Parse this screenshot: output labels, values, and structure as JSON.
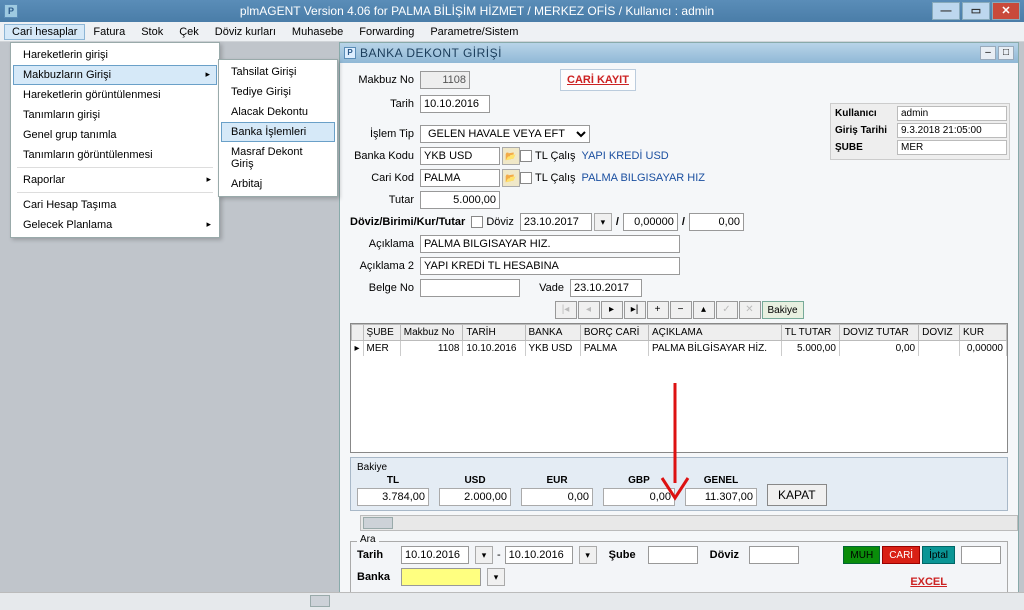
{
  "app": {
    "icon": "P",
    "title": "plmAGENT  Version 4.06 for  PALMA BİLİŞİM HİZMET  /   MERKEZ OFİS /      Kullanıcı : admin"
  },
  "menubar": [
    "Cari hesaplar",
    "Fatura",
    "Stok",
    "Çek",
    "Döviz kurları",
    "Muhasebe",
    "Forwarding",
    "Parametre/Sistem"
  ],
  "dropdown1": [
    {
      "label": "Hareketlerin girişi"
    },
    {
      "label": "Makbuzların Girişi",
      "arrow": true,
      "highlight": true
    },
    {
      "label": "Hareketlerin  görüntülenmesi"
    },
    {
      "label": "Tanımların girişi"
    },
    {
      "label": "Genel grup tanımla"
    },
    {
      "label": "Tanımların görüntülenmesi"
    },
    {
      "sep": true
    },
    {
      "label": "Raporlar",
      "arrow": true
    },
    {
      "sep": true
    },
    {
      "label": "Cari Hesap Taşıma"
    },
    {
      "label": "Gelecek Planlama",
      "arrow": true
    }
  ],
  "dropdown2": [
    {
      "label": "Tahsilat Girişi"
    },
    {
      "label": "Tediye Girişi"
    },
    {
      "label": "Alacak Dekontu"
    },
    {
      "label": "Banka İşlemleri",
      "highlight": true
    },
    {
      "label": "Masraf Dekont Giriş"
    },
    {
      "label": "Arbitaj"
    }
  ],
  "inner": {
    "title": "BANKA DEKONT  GİRİŞİ",
    "cari_kayit": "CARİ KAYIT",
    "labels": {
      "makbuz_no": "Makbuz No",
      "tarih": "Tarih",
      "islem_tip": "İşlem Tip",
      "banka_kodu": "Banka Kodu",
      "cari_kod": "Cari Kod",
      "tutar": "Tutar",
      "doviz_line": "Döviz/Birimi/Kur/Tutar",
      "doviz_chk": "Döviz",
      "aciklama": "Açıklama",
      "aciklama2": "Açıklama 2",
      "belge_no": "Belge No",
      "vade": "Vade",
      "tl_calis": "TL Çalış"
    },
    "values": {
      "makbuz_no": "1108",
      "tarih": "10.10.2016",
      "islem_tip": "GELEN HAVALE VEYA EFT",
      "banka_kodu": "YKB USD",
      "banka_name": "YAPI KREDİ USD",
      "cari_kod": "PALMA",
      "cari_name": "PALMA BILGISAYAR HIZ",
      "tutar": "5.000,00",
      "doviz_date": "23.10.2017",
      "doviz_kur": "0,00000",
      "doviz_tutar": "0,00",
      "aciklama": "PALMA BILGISAYAR HIZ.",
      "aciklama2": "YAPI KREDİ TL HESABINA",
      "belge_no": "",
      "vade": "23.10.2017"
    },
    "info": {
      "kullanici_lbl": "Kullanıcı",
      "kullanici": "admin",
      "giris_lbl": "Giriş Tarihi",
      "giris": "9.3.2018 21:05:00",
      "sube_lbl": "ŞUBE",
      "sube": "MER"
    },
    "nav": {
      "bakiye": "Bakiye"
    },
    "grid": {
      "headers": [
        "ŞUBE",
        "Makbuz No",
        "TARİH",
        "BANKA",
        "BORÇ CARİ",
        "AÇIKLAMA",
        "TL TUTAR",
        "DOVIZ TUTAR",
        "DOVIZ",
        "KUR"
      ],
      "row": [
        "MER",
        "1108",
        "10.10.2016",
        "YKB USD",
        "PALMA",
        "PALMA BİLGİSAYAR HİZ.",
        "5.000,00",
        "0,00",
        "",
        "0,00000"
      ]
    },
    "bakiye": {
      "label": "Bakiye",
      "cols": [
        {
          "h": "TL",
          "v": "3.784,00"
        },
        {
          "h": "USD",
          "v": "2.000,00"
        },
        {
          "h": "EUR",
          "v": "0,00"
        },
        {
          "h": "GBP",
          "v": "0,00"
        },
        {
          "h": "GENEL",
          "v": "11.307,00"
        }
      ],
      "kapat": "KAPAT"
    },
    "ara": {
      "title": "Ara",
      "tarih_lbl": "Tarih",
      "tarih1": "10.10.2016",
      "tarih2": "10.10.2016",
      "sube_lbl": "Şube",
      "doviz_lbl": "Döviz",
      "banka_lbl": "Banka",
      "btn_muh": "MUH",
      "btn_cari": "CARİ",
      "btn_iptal": "İptal",
      "excel": "EXCEL"
    }
  }
}
